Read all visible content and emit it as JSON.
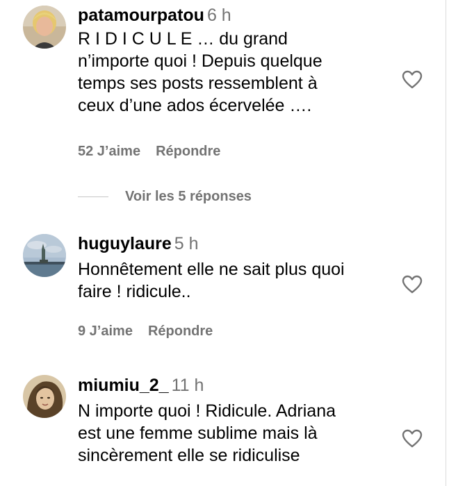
{
  "comments": [
    {
      "username": "patamourpatou",
      "time": "6 h",
      "lines": [
        "R I D I C U L E … du grand",
        "n’importe quoi ! Depuis quelque",
        "temps ses posts ressemblent à",
        "ceux d’une ados écervelée …."
      ],
      "likes": "52 J’aime",
      "reply_label": "Répondre",
      "avatar": "avatar-blonde-woman",
      "view_replies": "Voir les 5 réponses"
    },
    {
      "username": "huguylaure",
      "time": "5 h",
      "lines": [
        "Honnêtement elle ne sait plus quoi",
        "faire ! ridicule.."
      ],
      "likes": "9 J’aime",
      "reply_label": "Répondre",
      "avatar": "avatar-statue-of-liberty"
    },
    {
      "username": "miumiu_2_",
      "time": "11 h",
      "lines": [
        "N importe quoi ! Ridicule. Adriana",
        "est une femme sublime mais là",
        "sincèrement elle se ridiculise"
      ],
      "avatar": "avatar-woman-sepia"
    }
  ],
  "icons": {
    "like": "heart-icon"
  },
  "colors": {
    "text": "#000000",
    "secondary": "#737373",
    "divider": "#c7c7c7"
  }
}
